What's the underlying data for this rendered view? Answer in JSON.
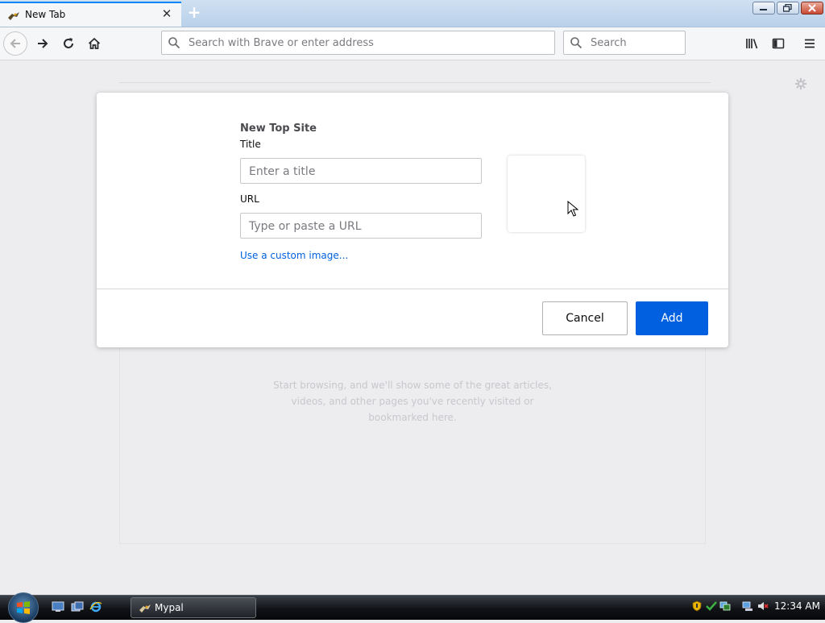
{
  "window": {
    "tab_title": "New Tab",
    "tab_favicon": "mypal-icon",
    "new_tab": "+"
  },
  "navbar": {
    "address_placeholder": "Search with Brave or enter address",
    "search_placeholder": "Search"
  },
  "content": {
    "empty_message": "Start browsing, and we'll show some of the great articles, videos, and other pages you've recently visited or bookmarked here."
  },
  "modal": {
    "heading": "New Top Site",
    "title_label": "Title",
    "title_placeholder": "Enter a title",
    "url_label": "URL",
    "url_placeholder": "Type or paste a URL",
    "custom_image_link": "Use a custom image...",
    "cancel_label": "Cancel",
    "add_label": "Add"
  },
  "taskbar": {
    "task_label": "Mypal",
    "clock": "12:34 AM"
  },
  "colors": {
    "accent": "#0060df",
    "tab_highlight": "#0a84ff",
    "page_background": "#ededf0"
  }
}
